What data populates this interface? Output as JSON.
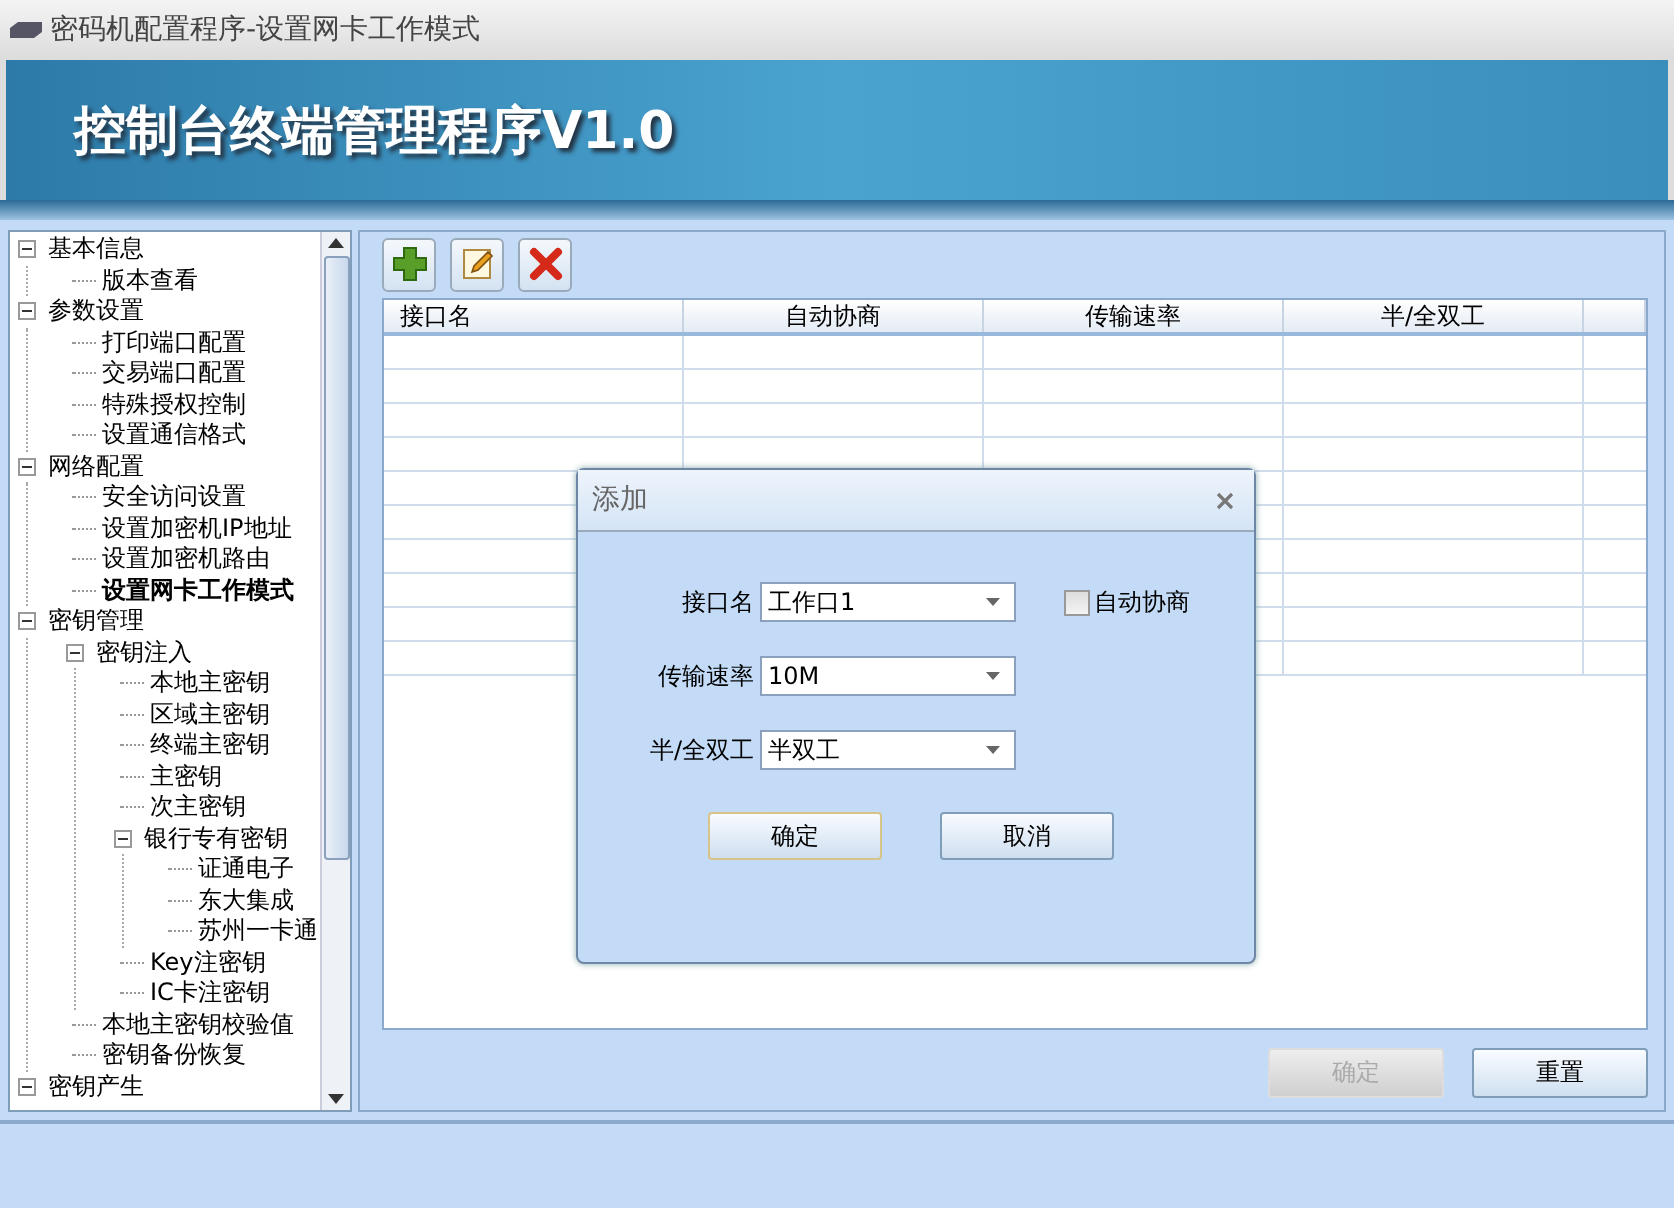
{
  "window": {
    "title": "密码机配置程序-设置网卡工作模式"
  },
  "banner": {
    "title": "控制台终端管理程序V1.0"
  },
  "tree": [
    {
      "label": "基本信息",
      "expanded": true,
      "selected": false,
      "children": [
        {
          "label": "版本查看",
          "selected": false
        }
      ]
    },
    {
      "label": "参数设置",
      "expanded": true,
      "selected": false,
      "children": [
        {
          "label": "打印端口配置",
          "selected": false
        },
        {
          "label": "交易端口配置",
          "selected": false
        },
        {
          "label": "特殊授权控制",
          "selected": false
        },
        {
          "label": "设置通信格式",
          "selected": false
        }
      ]
    },
    {
      "label": "网络配置",
      "expanded": true,
      "selected": false,
      "children": [
        {
          "label": "安全访问设置",
          "selected": false
        },
        {
          "label": "设置加密机IP地址",
          "selected": false
        },
        {
          "label": "设置加密机路由",
          "selected": false
        },
        {
          "label": "设置网卡工作模式",
          "selected": true
        }
      ]
    },
    {
      "label": "密钥管理",
      "expanded": true,
      "selected": false,
      "children": [
        {
          "label": "密钥注入",
          "expanded": true,
          "selected": false,
          "children": [
            {
              "label": "本地主密钥",
              "selected": false
            },
            {
              "label": "区域主密钥",
              "selected": false
            },
            {
              "label": "终端主密钥",
              "selected": false
            },
            {
              "label": "主密钥",
              "selected": false
            },
            {
              "label": "次主密钥",
              "selected": false
            },
            {
              "label": "银行专有密钥",
              "expanded": true,
              "selected": false,
              "children": [
                {
                  "label": "证通电子",
                  "selected": false
                },
                {
                  "label": "东大集成",
                  "selected": false
                },
                {
                  "label": "苏州一卡通",
                  "selected": false
                }
              ]
            },
            {
              "label": "Key注密钥",
              "selected": false
            },
            {
              "label": "IC卡注密钥",
              "selected": false
            }
          ]
        },
        {
          "label": "本地主密钥校验值",
          "selected": false
        },
        {
          "label": "密钥备份恢复",
          "selected": false
        }
      ]
    },
    {
      "label": "密钥产生",
      "expanded": true,
      "selected": false
    }
  ],
  "toolbar": [
    {
      "kind": "add"
    },
    {
      "kind": "edit"
    },
    {
      "kind": "delete"
    }
  ],
  "table": {
    "columns": [
      "接口名",
      "自动协商",
      "传输速率",
      "半/全双工"
    ]
  },
  "dialog": {
    "title": "添加",
    "fields": [
      {
        "label": "接口名",
        "value": "工作口1",
        "checkbox": {
          "label": "自动协商",
          "checked": false
        }
      },
      {
        "label": "传输速率",
        "value": "10M"
      },
      {
        "label": "半/全双工",
        "value": "半双工"
      }
    ],
    "buttons": [
      {
        "label": "确定",
        "focused": true
      },
      {
        "label": "取消",
        "focused": false
      }
    ]
  },
  "buttons": [
    {
      "label": "确定",
      "disabled": true
    },
    {
      "label": "重置",
      "disabled": false
    }
  ]
}
